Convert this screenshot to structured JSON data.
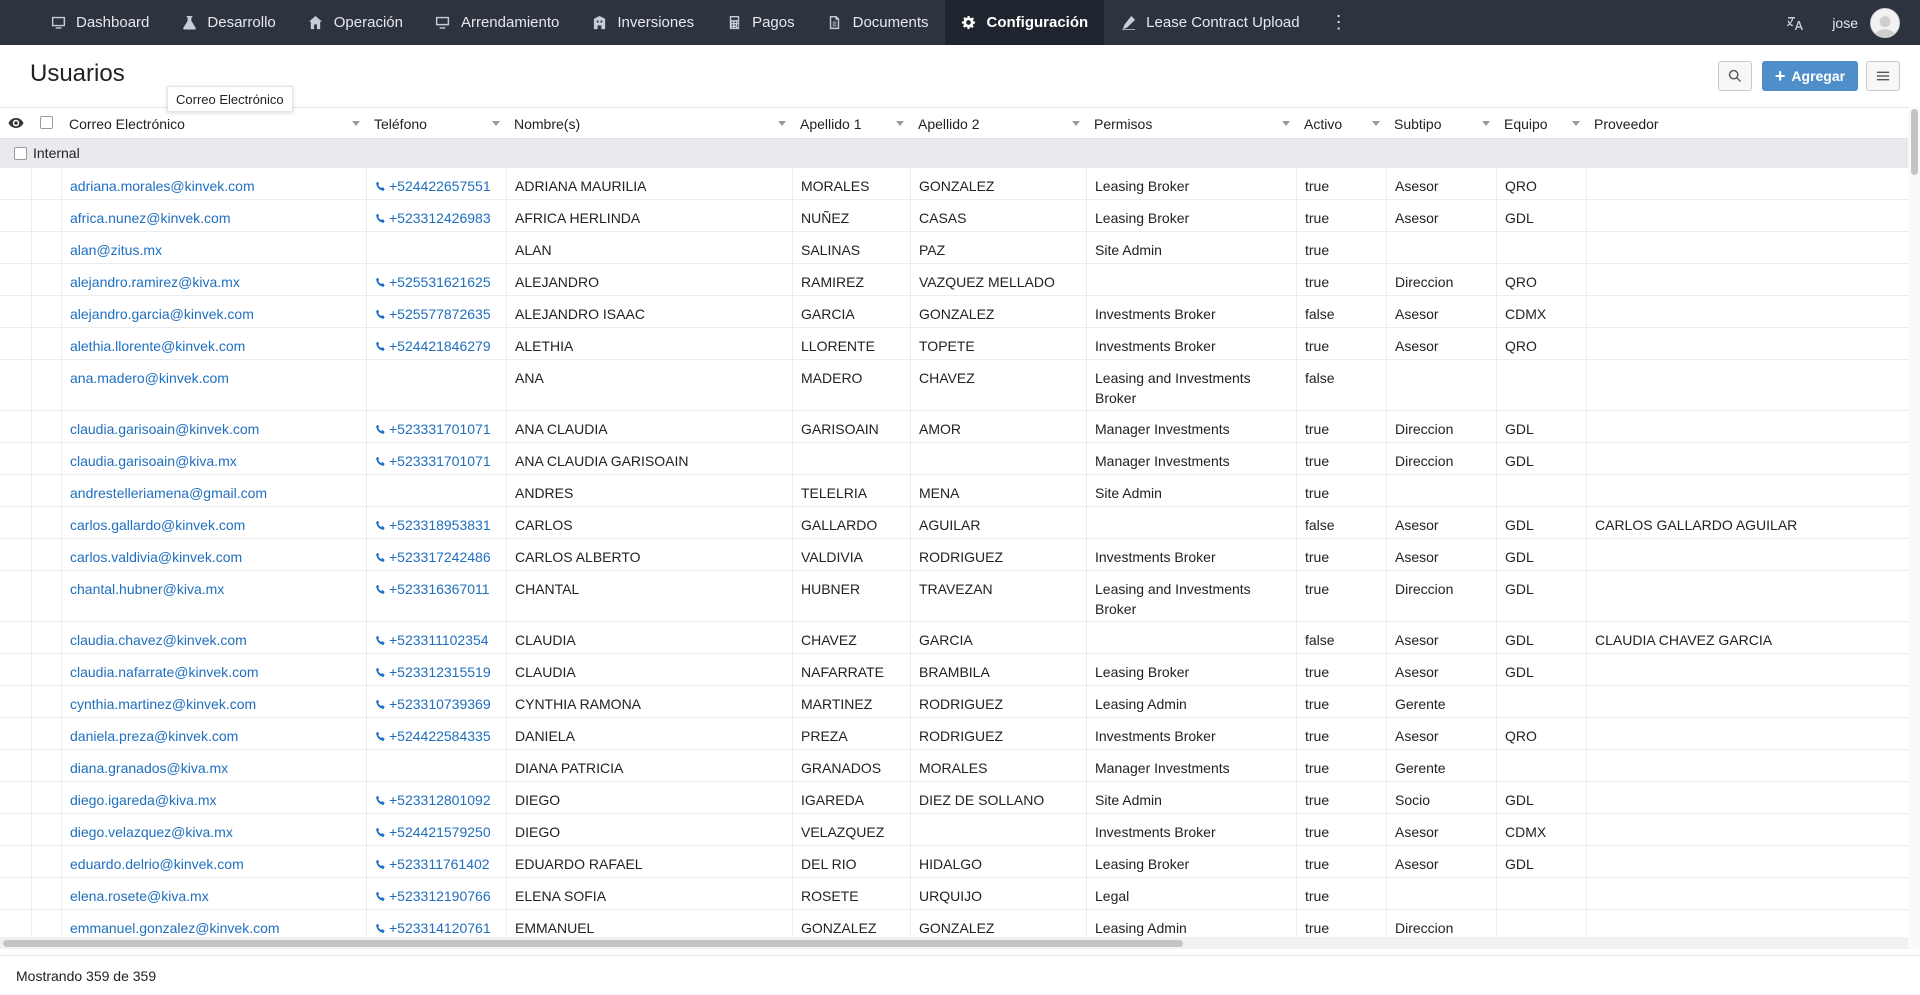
{
  "nav": {
    "items": [
      {
        "label": "Dashboard",
        "icon": "dashboard-icon"
      },
      {
        "label": "Desarrollo",
        "icon": "flask-icon"
      },
      {
        "label": "Operación",
        "icon": "home-icon"
      },
      {
        "label": "Arrendamiento",
        "icon": "monitor-icon"
      },
      {
        "label": "Inversiones",
        "icon": "building-icon"
      },
      {
        "label": "Pagos",
        "icon": "calculator-icon"
      },
      {
        "label": "Documents",
        "icon": "document-icon"
      },
      {
        "label": "Configuración",
        "icon": "gear-icon"
      },
      {
        "label": "Lease Contract Upload",
        "icon": "pen-icon"
      }
    ],
    "active": "Configuración",
    "more_glyph": "⋮",
    "user_name": "jose"
  },
  "page": {
    "title": "Usuarios",
    "tooltip": "Correo Electrónico",
    "add_button": "Agregar",
    "add_glyph": "+"
  },
  "columns": [
    {
      "key": "email",
      "label": "Correo Electrónico"
    },
    {
      "key": "phone",
      "label": "Teléfono"
    },
    {
      "key": "names",
      "label": "Nombre(s)"
    },
    {
      "key": "last1",
      "label": "Apellido 1"
    },
    {
      "key": "last2",
      "label": "Apellido 2"
    },
    {
      "key": "perms",
      "label": "Permisos"
    },
    {
      "key": "active",
      "label": "Activo"
    },
    {
      "key": "subtype",
      "label": "Subtipo"
    },
    {
      "key": "team",
      "label": "Equipo"
    },
    {
      "key": "provider",
      "label": "Proveedor"
    }
  ],
  "group": {
    "label": "Internal"
  },
  "rows": [
    {
      "email": "adriana.morales@kinvek.com",
      "phone": "+524422657551",
      "names": "ADRIANA MAURILIA",
      "last1": "MORALES",
      "last2": "GONZALEZ",
      "perms": "Leasing Broker",
      "active": "true",
      "subtype": "Asesor",
      "team": "QRO",
      "provider": ""
    },
    {
      "email": "africa.nunez@kinvek.com",
      "phone": "+523312426983",
      "names": "AFRICA HERLINDA",
      "last1": "NUÑEZ",
      "last2": "CASAS",
      "perms": "Leasing Broker",
      "active": "true",
      "subtype": "Asesor",
      "team": "GDL",
      "provider": ""
    },
    {
      "email": "alan@zitus.mx",
      "phone": "",
      "names": "ALAN",
      "last1": "SALINAS",
      "last2": "PAZ",
      "perms": "Site Admin",
      "active": "true",
      "subtype": "",
      "team": "",
      "provider": ""
    },
    {
      "email": "alejandro.ramirez@kiva.mx",
      "phone": "+525531621625",
      "names": "ALEJANDRO",
      "last1": "RAMIREZ",
      "last2": "VAZQUEZ MELLADO",
      "perms": "",
      "active": "true",
      "subtype": "Direccion",
      "team": "QRO",
      "provider": ""
    },
    {
      "email": "alejandro.garcia@kinvek.com",
      "phone": "+525577872635",
      "names": "ALEJANDRO ISAAC",
      "last1": "GARCIA",
      "last2": "GONZALEZ",
      "perms": "Investments Broker",
      "active": "false",
      "subtype": "Asesor",
      "team": "CDMX",
      "provider": ""
    },
    {
      "email": "alethia.llorente@kinvek.com",
      "phone": "+524421846279",
      "names": "ALETHIA",
      "last1": "LLORENTE",
      "last2": "TOPETE",
      "perms": "Investments Broker",
      "active": "true",
      "subtype": "Asesor",
      "team": "QRO",
      "provider": ""
    },
    {
      "email": "ana.madero@kinvek.com",
      "phone": "",
      "names": "ANA",
      "last1": "MADERO",
      "last2": "CHAVEZ",
      "perms": "Leasing and Investments Broker",
      "active": "false",
      "subtype": "",
      "team": "",
      "provider": "",
      "tall": true
    },
    {
      "email": "claudia.garisoain@kinvek.com",
      "phone": "+523331701071",
      "names": "ANA CLAUDIA",
      "last1": "GARISOAIN",
      "last2": "AMOR",
      "perms": "Manager Investments",
      "active": "true",
      "subtype": "Direccion",
      "team": "GDL",
      "provider": ""
    },
    {
      "email": "claudia.garisoain@kiva.mx",
      "phone": "+523331701071",
      "names": "ANA CLAUDIA GARISOAIN",
      "last1": "",
      "last2": "",
      "perms": "Manager Investments",
      "active": "true",
      "subtype": "Direccion",
      "team": "GDL",
      "provider": ""
    },
    {
      "email": "andrestelleriamena@gmail.com",
      "phone": "",
      "names": "ANDRES",
      "last1": "TELELRIA",
      "last2": "MENA",
      "perms": "Site Admin",
      "active": "true",
      "subtype": "",
      "team": "",
      "provider": ""
    },
    {
      "email": "carlos.gallardo@kinvek.com",
      "phone": "+523318953831",
      "names": "CARLOS",
      "last1": "GALLARDO",
      "last2": "AGUILAR",
      "perms": "",
      "active": "false",
      "subtype": "Asesor",
      "team": "GDL",
      "provider": "CARLOS GALLARDO AGUILAR"
    },
    {
      "email": "carlos.valdivia@kinvek.com",
      "phone": "+523317242486",
      "names": "CARLOS ALBERTO",
      "last1": "VALDIVIA",
      "last2": "RODRIGUEZ",
      "perms": "Investments Broker",
      "active": "true",
      "subtype": "Asesor",
      "team": "GDL",
      "provider": ""
    },
    {
      "email": "chantal.hubner@kiva.mx",
      "phone": "+523316367011",
      "names": "CHANTAL",
      "last1": "HUBNER",
      "last2": "TRAVEZAN",
      "perms": "Leasing and Investments Broker",
      "active": "true",
      "subtype": "Direccion",
      "team": "GDL",
      "provider": "",
      "tall": true
    },
    {
      "email": "claudia.chavez@kinvek.com",
      "phone": "+523311102354",
      "names": "CLAUDIA",
      "last1": "CHAVEZ",
      "last2": "GARCIA",
      "perms": "",
      "active": "false",
      "subtype": "Asesor",
      "team": "GDL",
      "provider": "CLAUDIA CHAVEZ GARCIA"
    },
    {
      "email": "claudia.nafarrate@kinvek.com",
      "phone": "+523312315519",
      "names": "CLAUDIA",
      "last1": "NAFARRATE",
      "last2": "BRAMBILA",
      "perms": "Leasing Broker",
      "active": "true",
      "subtype": "Asesor",
      "team": "GDL",
      "provider": ""
    },
    {
      "email": "cynthia.martinez@kinvek.com",
      "phone": "+523310739369",
      "names": "CYNTHIA RAMONA",
      "last1": "MARTINEZ",
      "last2": "RODRIGUEZ",
      "perms": "Leasing Admin",
      "active": "true",
      "subtype": "Gerente",
      "team": "",
      "provider": ""
    },
    {
      "email": "daniela.preza@kinvek.com",
      "phone": "+524422584335",
      "names": "DANIELA",
      "last1": "PREZA",
      "last2": "RODRIGUEZ",
      "perms": "Investments Broker",
      "active": "true",
      "subtype": "Asesor",
      "team": "QRO",
      "provider": ""
    },
    {
      "email": "diana.granados@kiva.mx",
      "phone": "",
      "names": "DIANA PATRICIA",
      "last1": "GRANADOS",
      "last2": "MORALES",
      "perms": "Manager Investments",
      "active": "true",
      "subtype": "Gerente",
      "team": "",
      "provider": ""
    },
    {
      "email": "diego.igareda@kiva.mx",
      "phone": "+523312801092",
      "names": "DIEGO",
      "last1": "IGAREDA",
      "last2": "DIEZ DE SOLLANO",
      "perms": "Site Admin",
      "active": "true",
      "subtype": "Socio",
      "team": "GDL",
      "provider": ""
    },
    {
      "email": "diego.velazquez@kiva.mx",
      "phone": "+524421579250",
      "names": "DIEGO",
      "last1": "VELAZQUEZ",
      "last2": "",
      "perms": "Investments Broker",
      "active": "true",
      "subtype": "Asesor",
      "team": "CDMX",
      "provider": ""
    },
    {
      "email": "eduardo.delrio@kinvek.com",
      "phone": "+523311761402",
      "names": "EDUARDO RAFAEL",
      "last1": "DEL RIO",
      "last2": "HIDALGO",
      "perms": "Leasing Broker",
      "active": "true",
      "subtype": "Asesor",
      "team": "GDL",
      "provider": ""
    },
    {
      "email": "elena.rosete@kiva.mx",
      "phone": "+523312190766",
      "names": "ELENA SOFIA",
      "last1": "ROSETE",
      "last2": "URQUIJO",
      "perms": "Legal",
      "active": "true",
      "subtype": "",
      "team": "",
      "provider": ""
    },
    {
      "email": "emmanuel.gonzalez@kinvek.com",
      "phone": "+523314120761",
      "names": "EMMANUEL",
      "last1": "GONZALEZ",
      "last2": "GONZALEZ",
      "perms": "Leasing Admin",
      "active": "true",
      "subtype": "Direccion",
      "team": "",
      "provider": ""
    }
  ],
  "footer": {
    "text": "Mostrando 359 de 359"
  }
}
